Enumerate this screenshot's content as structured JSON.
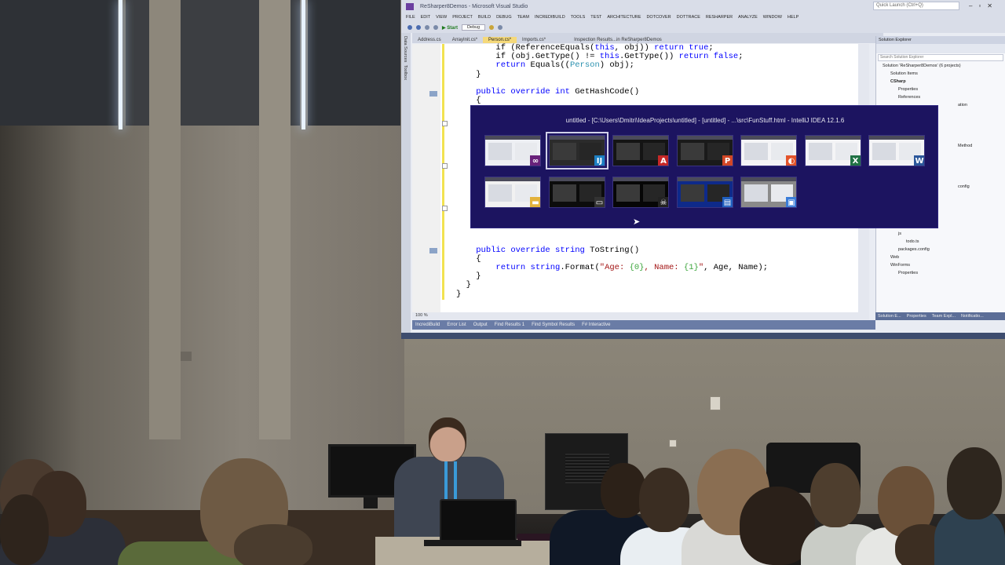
{
  "vs": {
    "title": "ReSharper8Demos - Microsoft Visual Studio",
    "quick_launch": "Quick Launch (Ctrl+Q)",
    "menu": [
      "FILE",
      "EDIT",
      "VIEW",
      "PROJECT",
      "BUILD",
      "DEBUG",
      "TEAM",
      "INCREDIBUILD",
      "TOOLS",
      "TEST",
      "ARCHITECTURE",
      "DOTCOVER",
      "DOTTRACE",
      "RESHARPER",
      "ANALYZE",
      "WINDOW",
      "HELP"
    ],
    "toolbar": {
      "start": "▶ Start",
      "config": "Debug"
    },
    "left_tabs": [
      "Data Sources",
      "Toolbox"
    ],
    "doc_tabs": [
      {
        "label": "Address.cs",
        "active": false
      },
      {
        "label": "ArrayInit.cs*",
        "active": false
      },
      {
        "label": "Person.cs*",
        "active": true
      },
      {
        "label": "Imports.cs*",
        "active": false
      },
      {
        "label": "Inspection Results...in ReSharper8Demos",
        "active": false
      }
    ],
    "code": {
      "l1": {
        "a": "if (ReferenceEquals(",
        "b": "this",
        "c": ", obj)) ",
        "d": "return true",
        "e": ";"
      },
      "l2": {
        "a": "if (obj.GetType() != ",
        "b": "this",
        "c": ".GetType()) ",
        "d": "return false",
        "e": ";"
      },
      "l3": {
        "a": "return ",
        "b": "Equals((",
        "c": "Person",
        "d": ") obj);"
      },
      "l4": "}",
      "l5": {
        "a": "public override int ",
        "b": "GetHashCode()"
      },
      "l6": "{",
      "l7": "}",
      "l8": "{",
      "l9": "}",
      "l10": {
        "a": "public override string ",
        "b": "ToString()"
      },
      "l11": "{",
      "l12": {
        "a": "return ",
        "b": "string",
        "c": ".Format(",
        "d": "\"Age: ",
        "e": "{0}",
        "f": ", Name: ",
        "g": "{1}",
        "h": "\"",
        "i": ", Age, Name);"
      },
      "l13": "}",
      "l14": "}",
      "l15": "}"
    },
    "zoom": "100 %",
    "bottom_tabs": [
      "IncrediBuild",
      "Error List",
      "Output",
      "Find Results 1",
      "Find Symbol Results",
      "F# Interactive"
    ],
    "solution": {
      "header": "Solution Explorer",
      "search": "Search Solution Explorer",
      "items_top": [
        "Solution 'ReSharper8Demos' (6 projects)",
        "Solution Items",
        "CSharp",
        "Properties",
        "References"
      ],
      "items_bottom": [
        "Tests",
        "TodoMVC",
        "Properties",
        "References",
        "css",
        "js",
        "todo.ts",
        "packages.config",
        "Web",
        "WinForms",
        "Properties"
      ],
      "side_fragments": [
        "ation",
        "Method",
        "config"
      ],
      "bottom_tabs": [
        "Solution E...",
        "Properties",
        "Team Expl...",
        "Notificatio..."
      ]
    }
  },
  "switcher": {
    "title": "untitled - [C:\\Users\\Dmitri\\IdeaProjects\\untitled] - [untitled] - ...\\src\\FunStuff.html - IntelliJ IDEA 12.1.6",
    "row1": [
      {
        "app": "visual-studio",
        "badge": "∞",
        "badge_color": "#68217a",
        "bg": "#eef0f4"
      },
      {
        "app": "intellij-idea",
        "badge": "IJ",
        "badge_color": "#1d7fc2",
        "bg": "#2b2b2b",
        "selected": true
      },
      {
        "app": "acrobat-reader",
        "badge": "A",
        "badge_color": "#c62828",
        "bg": "#141414"
      },
      {
        "app": "powerpoint",
        "badge": "P",
        "badge_color": "#d24726",
        "bg": "#1a1a1a"
      },
      {
        "app": "browser",
        "badge": "◐",
        "badge_color": "#e3542b",
        "bg": "#f4f4f6"
      },
      {
        "app": "excel",
        "badge": "X",
        "badge_color": "#207245",
        "bg": "#f4f4f6"
      },
      {
        "app": "word",
        "badge": "W",
        "badge_color": "#2b579a",
        "bg": "#f4f4f6"
      }
    ],
    "row2": [
      {
        "app": "explorer",
        "badge": "▬",
        "badge_color": "#e3b23c",
        "bg": "#f1f1f1"
      },
      {
        "app": "console",
        "badge": "▭",
        "badge_color": "#333333",
        "bg": "#0c0c0c"
      },
      {
        "app": "terminal-app",
        "badge": "☠",
        "badge_color": "#222222",
        "bg": "#060606"
      },
      {
        "app": "powershell",
        "badge": "▤",
        "badge_color": "#1f5fbf",
        "bg": "#0e2a8a"
      },
      {
        "app": "remote-desktop",
        "badge": "▣",
        "badge_color": "#3b7dd8",
        "bg": "#8a8a8a"
      }
    ]
  },
  "colors": {
    "switcher_bg": "#1c1460",
    "vs_accent": "#68217a",
    "lanyard": "#3a9ad8"
  }
}
